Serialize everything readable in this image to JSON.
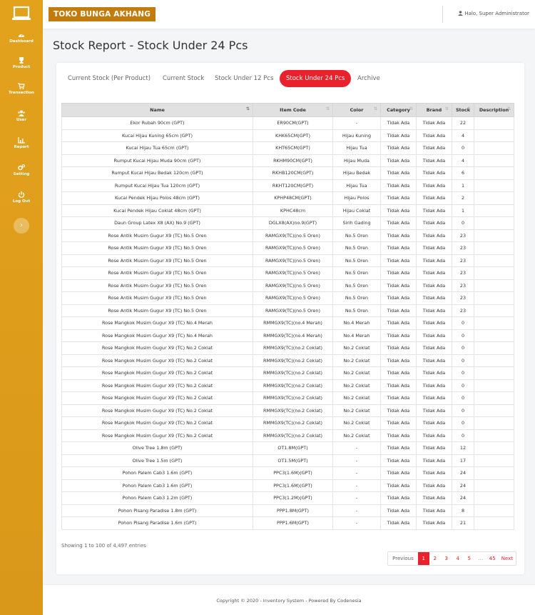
{
  "colors": {
    "sidebar": "#e3a21c",
    "brand_bg": "#c27c0e",
    "accent_red": "#e8212d"
  },
  "sidebar": {
    "items": [
      {
        "label": "Dashboard",
        "icon": "dashboard-icon"
      },
      {
        "label": "Product",
        "icon": "trophy-icon"
      },
      {
        "label": "Transaction",
        "icon": "cart-icon"
      },
      {
        "label": "User",
        "icon": "users-icon"
      },
      {
        "label": "Report",
        "icon": "chart-icon"
      },
      {
        "label": "Setting",
        "icon": "gears-icon"
      },
      {
        "label": "Log Out",
        "icon": "power-icon"
      }
    ],
    "toggle": "›"
  },
  "topbar": {
    "brand": "TOKO BUNGA AKHANG",
    "greeting": "Halo, Super Administrator"
  },
  "page": {
    "title": "Stock Report - Stock Under 24 Pcs"
  },
  "tabs": [
    {
      "label": "Current Stock (Per Product)"
    },
    {
      "label": "Current Stock"
    },
    {
      "label": "Stock Under 12 Pcs"
    },
    {
      "label": "Stock Under 24 Pcs",
      "active": true
    },
    {
      "label": "Archive"
    }
  ],
  "table": {
    "headers": [
      "Name",
      "Item Code",
      "Color",
      "Category",
      "Brand",
      "Stock",
      "Description"
    ],
    "rows": [
      [
        "Ekor Rubah 90cm (GPT)",
        "ER90CM(GPT)",
        "-",
        "Tidak Ada",
        "Tidak Ada",
        "22",
        ""
      ],
      [
        "Kucai Hijau Kuning 65cm (GPT)",
        "KHK65CM(GPT)",
        "Hijau Kuning",
        "Tidak Ada",
        "Tidak Ada",
        "4",
        ""
      ],
      [
        "Kucai Hijau Tua 65cm (GPT)",
        "KHT65CM(GPT)",
        "Hijau Tua",
        "Tidak Ada",
        "Tidak Ada",
        "0",
        ""
      ],
      [
        "Rumput Kucai Hijau Muda 90cm (GPT)",
        "RKHM90CM(GPT)",
        "Hijau Muda",
        "Tidak Ada",
        "Tidak Ada",
        "4",
        ""
      ],
      [
        "Rumput Kucai Hijau Bedak 120cm (GPT)",
        "RKHB120CM(GPT)",
        "Hijau Bedak",
        "Tidak Ada",
        "Tidak Ada",
        "6",
        ""
      ],
      [
        "Rumput Kucai Hijau Tua 120cm (GPT)",
        "RKHT120CM(GPT)",
        "Hijau Tua",
        "Tidak Ada",
        "Tidak Ada",
        "1",
        ""
      ],
      [
        "Kucai Pendek Hijau Polos 48cm (GPT)",
        "KPHP48CM(GPT)",
        "Hijau Polos",
        "Tidak Ada",
        "Tidak Ada",
        "2",
        ""
      ],
      [
        "Kucai Pendek Hijau Coklat 48cm (GPT)",
        "KPHC48cm",
        "Hijau Coklat",
        "Tidak Ada",
        "Tidak Ada",
        "1",
        ""
      ],
      [
        "Daun Group Latex X8 (AX) No.9 (GPT)",
        "DGLX8(AX)no.9(GPT)",
        "Sirih Gading",
        "Tidak Ada",
        "Tidak Ada",
        "0",
        ""
      ],
      [
        "Rose Antik Musim Gugur X9 (TC) No.5 Oren",
        "RAMGX9(TC)(no.5 Oren)",
        "No.5 Oren",
        "Tidak Ada",
        "Tidak Ada",
        "23",
        ""
      ],
      [
        "Rose Antik Musim Gugur X9 (TC) No.5 Oren",
        "RAMGX9(TC)(no.5 Oren)",
        "No.5 Oren",
        "Tidak Ada",
        "Tidak Ada",
        "23",
        ""
      ],
      [
        "Rose Antik Musim Gugur X9 (TC) No.5 Oren",
        "RAMGX9(TC)(no.5 Oren)",
        "No.5 Oren",
        "Tidak Ada",
        "Tidak Ada",
        "23",
        ""
      ],
      [
        "Rose Antik Musim Gugur X9 (TC) No.5 Oren",
        "RAMGX9(TC)(no.5 Oren)",
        "No.5 Oren",
        "Tidak Ada",
        "Tidak Ada",
        "23",
        ""
      ],
      [
        "Rose Antik Musim Gugur X9 (TC) No.5 Oren",
        "RAMGX9(TC)(no.5 Oren)",
        "No.5 Oren",
        "Tidak Ada",
        "Tidak Ada",
        "23",
        ""
      ],
      [
        "Rose Antik Musim Gugur X9 (TC) No.5 Oren",
        "RAMGX9(TC)(no.5 Oren)",
        "No.5 Oren",
        "Tidak Ada",
        "Tidak Ada",
        "23",
        ""
      ],
      [
        "Rose Antik Musim Gugur X9 (TC) No.5 Oren",
        "RAMGX9(TC)(no.5 Oren)",
        "No.5 Oren",
        "Tidak Ada",
        "Tidak Ada",
        "23",
        ""
      ],
      [
        "Rose Mangkok Musim Gugur X9 (TC) No.4 Merah",
        "RMMGX9(TC)(no.4 Merah)",
        "No.4 Merah",
        "Tidak Ada",
        "Tidak Ada",
        "0",
        ""
      ],
      [
        "Rose Mangkok Musim Gugur X9 (TC) No.4 Merah",
        "RMMGX9(TC)(no.4 Merah)",
        "No.4 Merah",
        "Tidak Ada",
        "Tidak Ada",
        "0",
        ""
      ],
      [
        "Rose Mangkok Musim Gugur X9 (TC) No.2 Coklat",
        "RMMGX9(TC)(no.2 Coklat)",
        "No.2 Coklat",
        "Tidak Ada",
        "Tidak Ada",
        "0",
        ""
      ],
      [
        "Rose Mangkok Musim Gugur X9 (TC) No.2 Coklat",
        "RMMGX9(TC)(no.2 Coklat)",
        "No.2 Coklat",
        "Tidak Ada",
        "Tidak Ada",
        "0",
        ""
      ],
      [
        "Rose Mangkok Musim Gugur X9 (TC) No.2 Coklat",
        "RMMGX9(TC)(no.2 Coklat)",
        "No.2 Coklat",
        "Tidak Ada",
        "Tidak Ada",
        "0",
        ""
      ],
      [
        "Rose Mangkok Musim Gugur X9 (TC) No.2 Coklat",
        "RMMGX9(TC)(no.2 Coklat)",
        "No.2 Coklat",
        "Tidak Ada",
        "Tidak Ada",
        "0",
        ""
      ],
      [
        "Rose Mangkok Musim Gugur X9 (TC) No.2 Coklat",
        "RMMGX9(TC)(no.2 Coklat)",
        "No.2 Coklat",
        "Tidak Ada",
        "Tidak Ada",
        "0",
        ""
      ],
      [
        "Rose Mangkok Musim Gugur X9 (TC) No.2 Coklat",
        "RMMGX9(TC)(no.2 Coklat)",
        "No.2 Coklat",
        "Tidak Ada",
        "Tidak Ada",
        "0",
        ""
      ],
      [
        "Rose Mangkok Musim Gugur X9 (TC) No.2 Coklat",
        "RMMGX9(TC)(no.2 Coklat)",
        "No.2 Coklat",
        "Tidak Ada",
        "Tidak Ada",
        "0",
        ""
      ],
      [
        "Rose Mangkok Musim Gugur X9 (TC) No.2 Coklat",
        "RMMGX9(TC)(no.2 Coklat)",
        "No.2 Coklat",
        "Tidak Ada",
        "Tidak Ada",
        "0",
        ""
      ],
      [
        "Olive Tree 1.8m (GPT)",
        "OT1.8M(GPT)",
        "-",
        "Tidak Ada",
        "Tidak Ada",
        "12",
        ""
      ],
      [
        "Olive Tree 1.5m (GPT)",
        "OT1.5M(GPT)",
        "-",
        "Tidak Ada",
        "Tidak Ada",
        "17",
        ""
      ],
      [
        "Pohon Palem Cab3 1.6m (GPT)",
        "PPC3(1.6M)(GPT)",
        "-",
        "Tidak Ada",
        "Tidak Ada",
        "24",
        ""
      ],
      [
        "Pohon Palem Cab3 1.6m (GPT)",
        "PPC3(1.6M)(GPT)",
        "-",
        "Tidak Ada",
        "Tidak Ada",
        "24",
        ""
      ],
      [
        "Pohon Palem Cab3 1.2m (GPT)",
        "PPC3(1.2M)(GPT)",
        "-",
        "Tidak Ada",
        "Tidak Ada",
        "24",
        ""
      ],
      [
        "Pohon Pisang Paradise 1.8m (GPT)",
        "PPP1.8M(GPT)",
        "-",
        "Tidak Ada",
        "Tidak Ada",
        "8",
        ""
      ],
      [
        "Pohon Pisang Paradise 1.6m (GPT)",
        "PPP1.6M(GPT)",
        "-",
        "Tidak Ada",
        "Tidak Ada",
        "21",
        ""
      ]
    ]
  },
  "entries": "Showing 1 to 100 of 4,497 entries",
  "pagination": [
    "Previous",
    "1",
    "2",
    "3",
    "4",
    "5",
    "...",
    "45",
    "Next"
  ],
  "footer": {
    "text": "Copyright © 2020 - Inventory System - Powered By Codenesia"
  }
}
